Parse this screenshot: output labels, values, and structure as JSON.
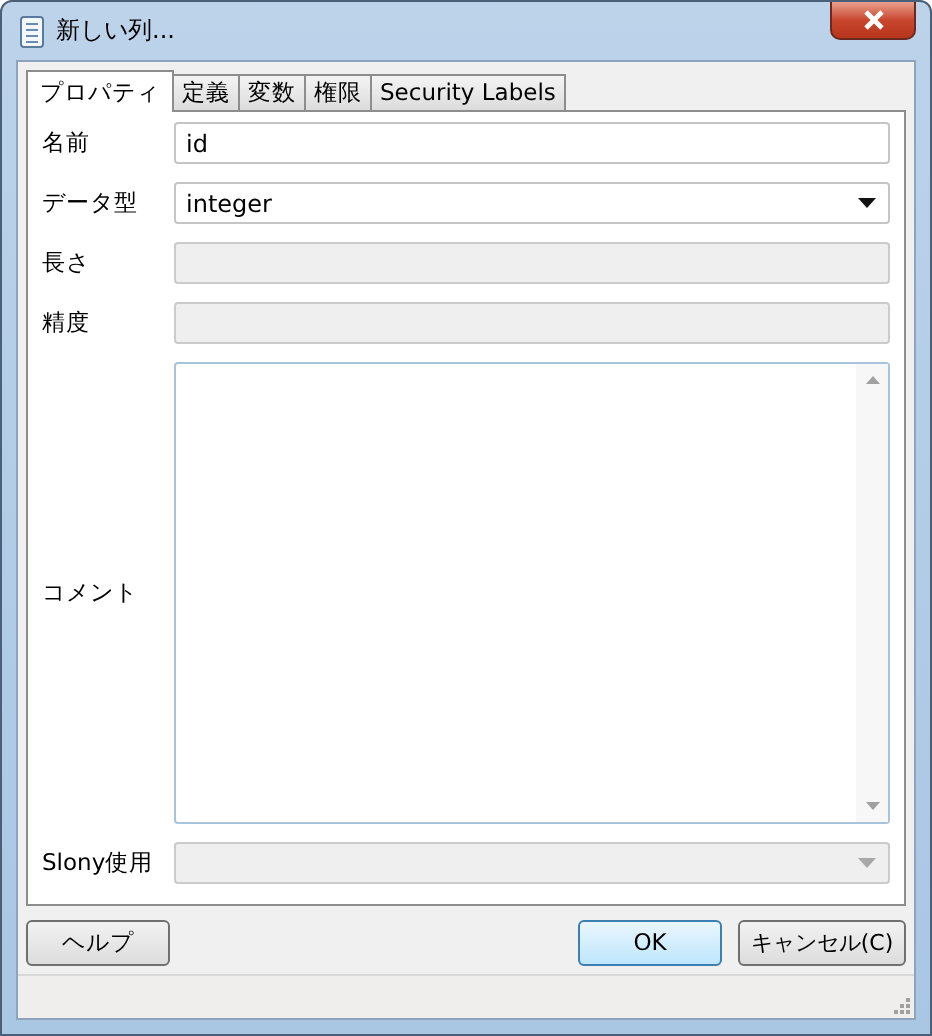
{
  "window": {
    "title": "新しい列..."
  },
  "tabs": [
    {
      "label": "プロパティ",
      "selected": true
    },
    {
      "label": "定義",
      "selected": false
    },
    {
      "label": "変数",
      "selected": false
    },
    {
      "label": "権限",
      "selected": false
    },
    {
      "label": "Security Labels",
      "selected": false
    }
  ],
  "fields": [
    {
      "label": "名前",
      "kind": "text",
      "value": "id",
      "disabled": false
    },
    {
      "label": "データ型",
      "kind": "select",
      "value": "integer",
      "disabled": false
    },
    {
      "label": "長さ",
      "kind": "text",
      "disabled": true
    },
    {
      "label": "精度",
      "kind": "text",
      "disabled": true
    },
    {
      "label": "コメント",
      "kind": "textarea",
      "disabled": false
    },
    {
      "label": "Slony使用",
      "kind": "select",
      "disabled": true
    }
  ],
  "buttons": {
    "help": "ヘルプ",
    "ok": "OK",
    "cancel": "キャンセル(C)"
  }
}
